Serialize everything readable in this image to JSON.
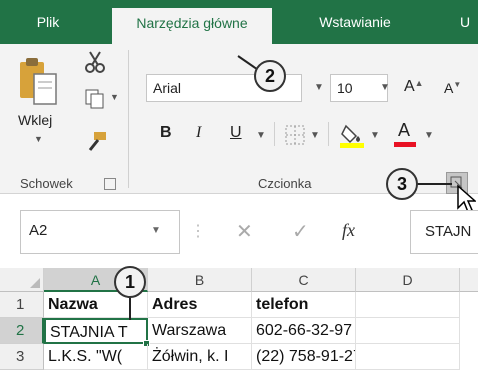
{
  "tabs": [
    {
      "label": "Plik"
    },
    {
      "label": "Narzędzia główne"
    },
    {
      "label": "Wstawianie"
    },
    {
      "label": "U"
    }
  ],
  "clipboard": {
    "paste_label": "Wklej",
    "group_label": "Schowek",
    "icons": [
      "paste-icon",
      "cut-icon",
      "copy-icon",
      "format-painter-icon"
    ]
  },
  "font": {
    "family_value": "Arial",
    "size_value": "10",
    "grow_label": "A",
    "shrink_label": "A",
    "bold_label": "B",
    "italic_label": "I",
    "underline_label": "U",
    "font_color_label": "A",
    "group_label": "Czcionka"
  },
  "formula_bar": {
    "name_box_value": "A2",
    "cancel_symbol": "✕",
    "enter_symbol": "✓",
    "fx_label": "fx",
    "formula_value": "STAJN"
  },
  "sheet": {
    "columns": [
      "A",
      "B",
      "C",
      "D"
    ],
    "rows": [
      {
        "num": "1",
        "cells": [
          "Nazwa",
          "Adres",
          "telefon",
          ""
        ]
      },
      {
        "num": "2",
        "cells": [
          "STAJNIA T",
          "Warszawa",
          "602-66-32-97",
          ""
        ]
      },
      {
        "num": "3",
        "cells": [
          "L.K.S. \"W(",
          "Żółwin, k. I",
          "(22) 758-91-27",
          ""
        ]
      }
    ]
  },
  "callouts": [
    "1",
    "2",
    "3"
  ],
  "colors": {
    "ribbon_green": "#217346",
    "selection_green": "#217346",
    "font_color_red": "#e81123",
    "fill_color_yellow": "#ffff00"
  }
}
